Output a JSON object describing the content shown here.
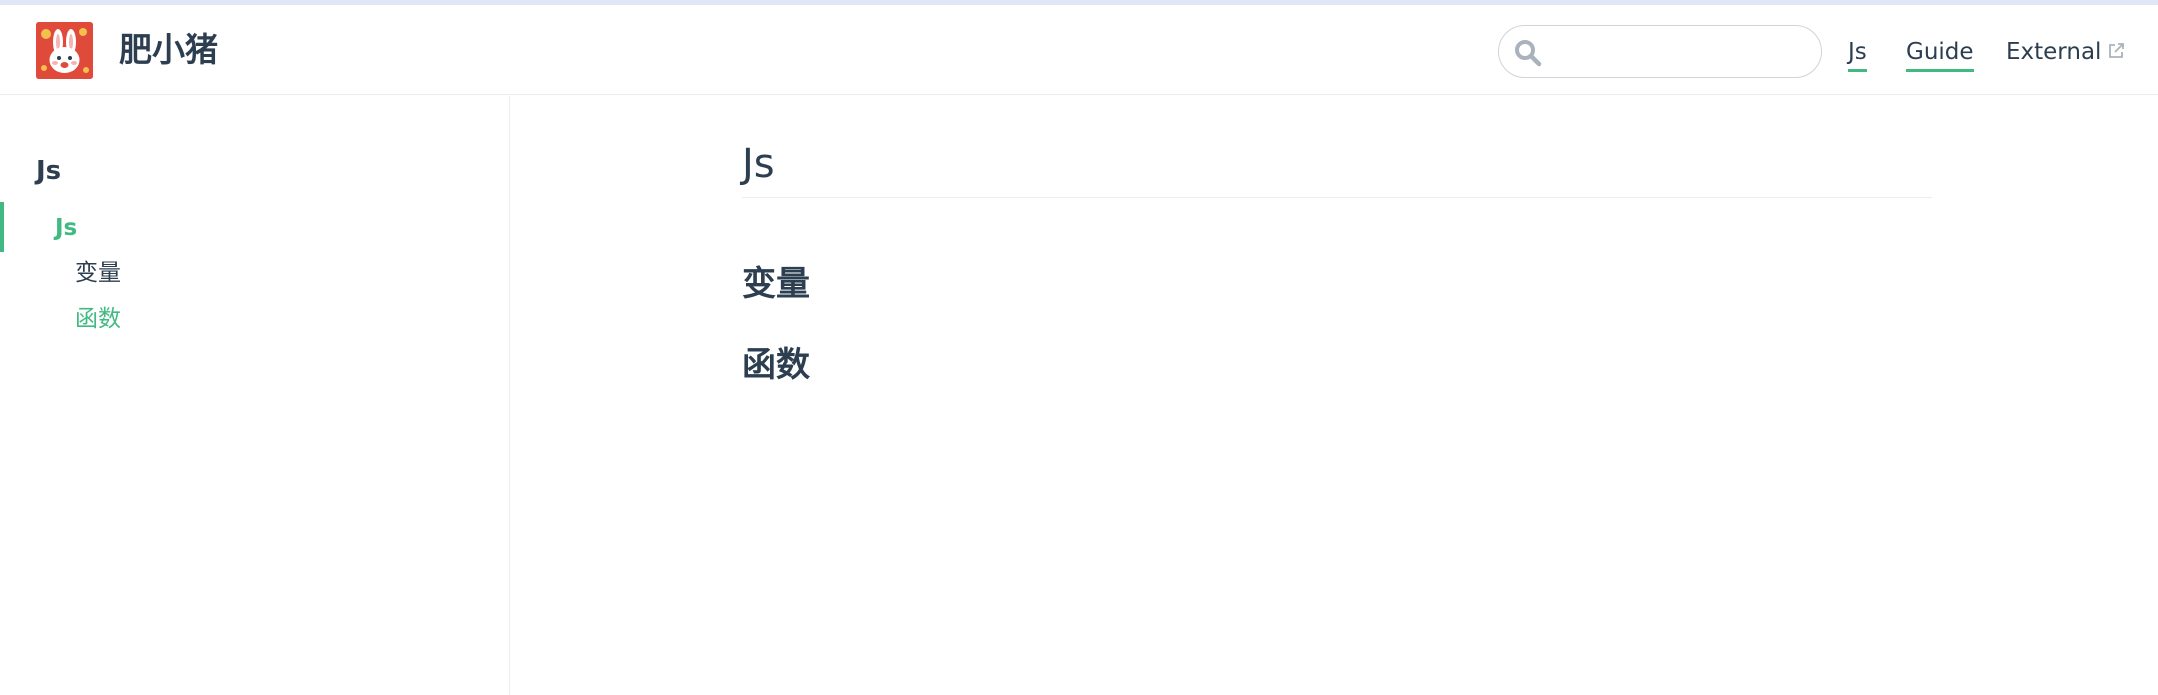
{
  "navbar": {
    "site_name": "肥小猪",
    "search": {
      "placeholder": "",
      "value": ""
    },
    "links": [
      {
        "label": "Js",
        "active": true
      },
      {
        "label": "Guide",
        "active": false
      },
      {
        "label": "External",
        "external": true
      }
    ]
  },
  "sidebar": {
    "heading": "Js",
    "active_group": "Js",
    "items": [
      {
        "label": "变量"
      },
      {
        "label": "函数",
        "active": true
      }
    ]
  },
  "main": {
    "title": "Js",
    "sections": [
      {
        "heading": "变量"
      },
      {
        "heading": "函数"
      }
    ]
  },
  "theme": {
    "accent": "#42b983",
    "text": "#2c3e50",
    "border": "#eaecef",
    "logo_bg": "#e04a3a"
  },
  "icons": {
    "logo": "rabbit-avatar-icon",
    "search": "search-icon",
    "external": "external-link-icon"
  }
}
